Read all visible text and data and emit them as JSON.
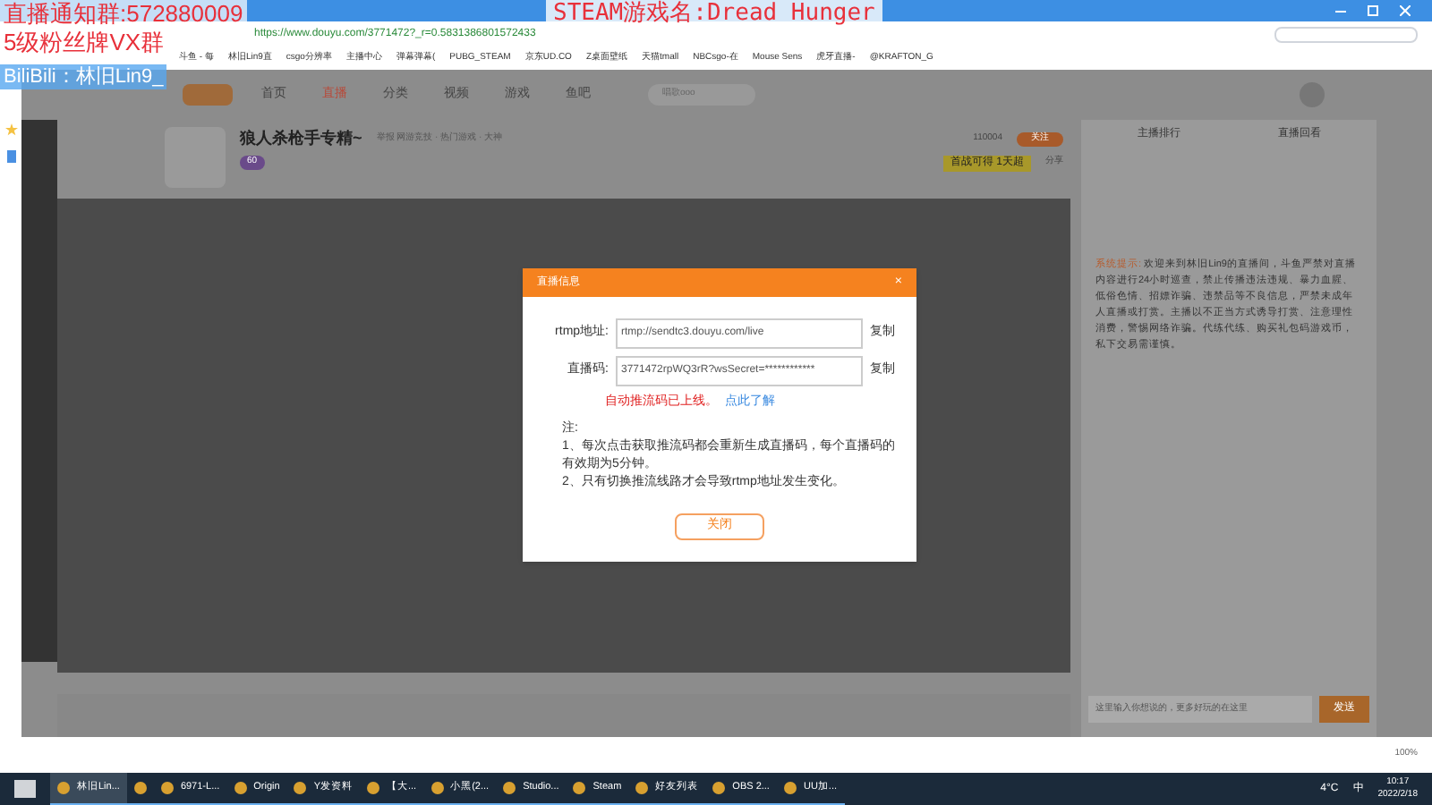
{
  "stream_overlays": {
    "notice": "直播通知群:572880009",
    "fan_group": "5级粉丝牌VX群",
    "bilibili": "BiliBili：林旧Lin9_",
    "game": "STEAM游戏名:Dread Hunger"
  },
  "browser": {
    "url": "https://www.douyu.com/3771472?_r=0.5831386801572433",
    "bookmarks": [
      "斗鱼 - 每",
      "林旧Lin9直",
      "csgo分辨率",
      "主播中心",
      "弹幕弹幕(",
      "PUBG_STEAM",
      "京东UD.CO",
      "Z桌面壁纸",
      "天猫tmall",
      "NBCsgo-在",
      "Mouse Sens",
      "虎牙直播-",
      "@KRAFTON_G"
    ],
    "zoom": "100%"
  },
  "site": {
    "nav": [
      {
        "label": "首页",
        "selected": false
      },
      {
        "label": "直播",
        "selected": true
      },
      {
        "label": "分类",
        "selected": false
      },
      {
        "label": "视频",
        "selected": false
      },
      {
        "label": "游戏",
        "selected": false
      },
      {
        "label": "鱼吧",
        "selected": false
      }
    ],
    "search_placeholder": "唱歌ooo",
    "room_title": "狼人杀枪手专精~",
    "room_meta": "举报  网游竞技 · 热门游戏 · 大神",
    "level": "60",
    "follow_count": "110004",
    "follow": "关注",
    "promo": "首战可得 1天超",
    "share": "分享",
    "rank_tabs": [
      "主播排行",
      "直播回看"
    ]
  },
  "dialog": {
    "title": "直播信息",
    "close": "×",
    "fields": [
      {
        "label": "rtmp地址:",
        "value": "rtmp://sendtc3.douyu.com/live",
        "copy": "复制"
      },
      {
        "label": "直播码:",
        "value": "3771472rpWQ3rR?wsSecret=************",
        "copy": "复制"
      }
    ],
    "warning": "自动推流码已上线。",
    "learn_more": "点此了解",
    "notes_title": "注:",
    "notes": [
      "1、每次点击获取推流码都会重新生成直播码，每个直播码的有效期为5分钟。",
      "2、只有切换推流线路才会导致rtmp地址发生变化。"
    ],
    "button": "关闭"
  },
  "chat": {
    "system_label": "系统提示:",
    "system_message": "欢迎来到林旧Lin9的直播间，斗鱼严禁对直播内容进行24小时巡查，禁止传播违法违规、暴力血腥、低俗色情、招嫖诈骗、违禁品等不良信息，严禁未成年人直播或打赏。主播以不正当方式诱导打赏、注意理性消费，警惕网络诈骗。代练代练、购买礼包码游戏币，私下交易需谨慎。",
    "input_placeholder": "这里输入你想说的，更多好玩的在这里",
    "send": "发送"
  },
  "taskbar": {
    "apps": [
      {
        "label": "林旧Lin...",
        "active": true
      },
      {
        "active": false
      },
      {
        "label": "6971-L...",
        "active": false
      },
      {
        "label": "Origin",
        "active": false
      },
      {
        "label": "Y发资料",
        "active": false
      },
      {
        "label": "【大...",
        "active": false
      },
      {
        "label": "小黑(2...",
        "active": false
      },
      {
        "label": "Studio...",
        "active": false
      },
      {
        "label": "Steam",
        "active": false
      },
      {
        "label": "好友列表",
        "active": false
      },
      {
        "label": "OBS 2...",
        "active": false
      },
      {
        "label": "UU加...",
        "active": false
      }
    ],
    "weather": "4°C",
    "ime": "中",
    "time": "10:17",
    "date": "2022/2/18"
  }
}
